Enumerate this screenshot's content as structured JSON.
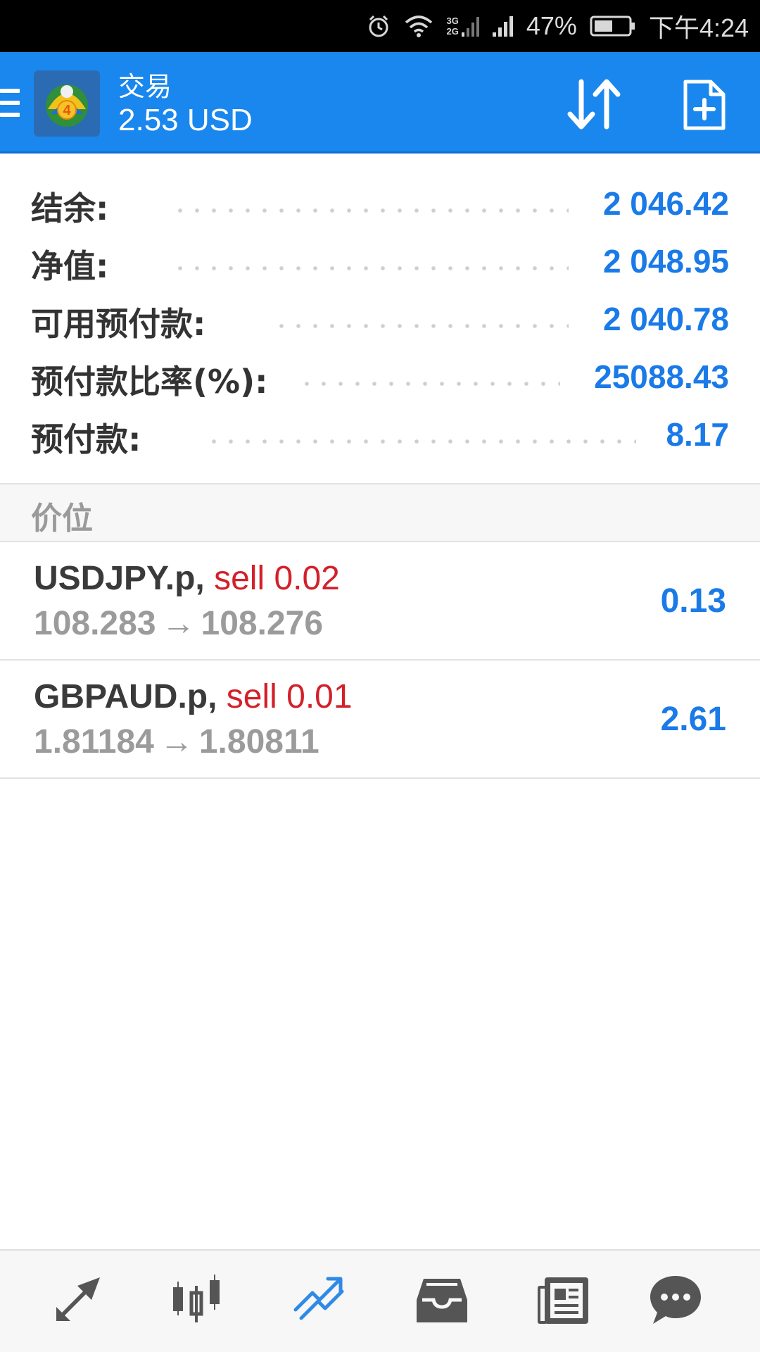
{
  "status_bar": {
    "battery_percent": "47%",
    "time": "下午4:24",
    "network_3g": "3G",
    "network_2g": "2G",
    "icons": [
      "alarm-icon",
      "wifi-icon",
      "cellular-signal-icon",
      "battery-icon"
    ]
  },
  "app_bar": {
    "title": "交易",
    "subtitle": "2.53 USD",
    "icons": [
      "menu-icon",
      "app-logo",
      "sort-icon",
      "new-order-icon"
    ],
    "logo_badge": "4"
  },
  "summary": {
    "rows": [
      {
        "label": "结余:",
        "value": "2 046.42"
      },
      {
        "label": "净值:",
        "value": "2 048.95"
      },
      {
        "label": "可用预付款:",
        "value": "2 040.78"
      },
      {
        "label": "预付款比率(%):",
        "value": "25088.43"
      },
      {
        "label": "预付款:",
        "value": "8.17"
      }
    ]
  },
  "positions_section": {
    "title": "价位",
    "items": [
      {
        "symbol": "USDJPY.p,",
        "type": "sell 0.02",
        "open_price": "108.283",
        "arrow": "→",
        "current_price": "108.276",
        "profit": "0.13"
      },
      {
        "symbol": "GBPAUD.p,",
        "type": "sell 0.01",
        "open_price": "1.81184",
        "arrow": "→",
        "current_price": "1.80811",
        "profit": "2.61"
      }
    ]
  },
  "bottom_nav": {
    "items": [
      {
        "icon": "quotes-icon",
        "active": false
      },
      {
        "icon": "chart-icon",
        "active": false
      },
      {
        "icon": "trade-icon",
        "active": true
      },
      {
        "icon": "history-icon",
        "active": false
      },
      {
        "icon": "news-icon",
        "active": false
      },
      {
        "icon": "messages-icon",
        "active": false
      }
    ]
  },
  "colors": {
    "app_bar": "#1a87ee",
    "value_blue": "#1a7ae8",
    "sell_red": "#d3202a",
    "muted_gray": "#9b9b9b",
    "nav_active": "#2f8ae6",
    "nav_inactive": "#555555"
  }
}
